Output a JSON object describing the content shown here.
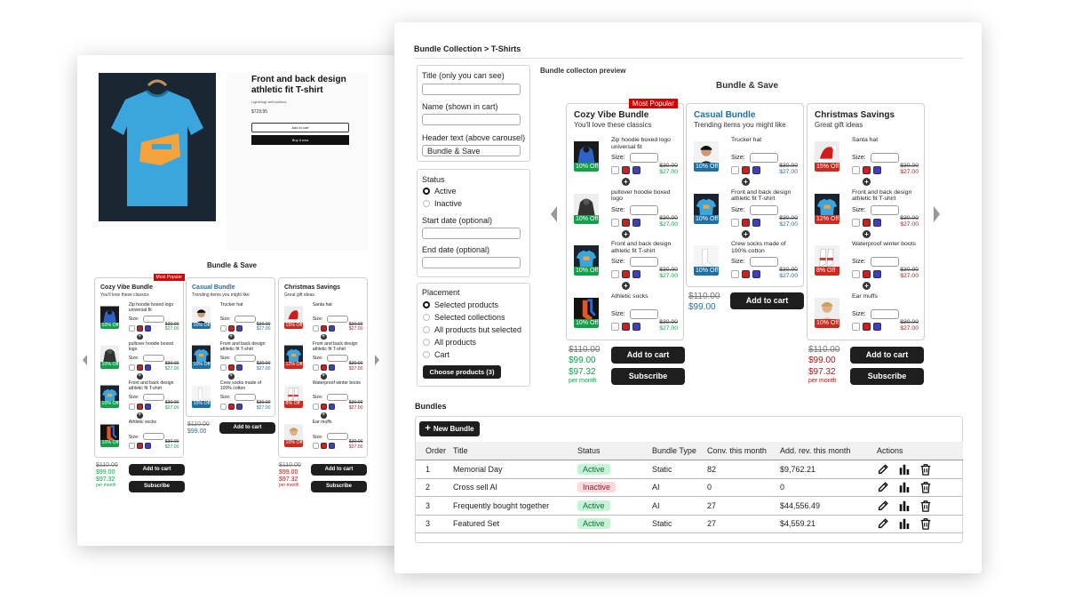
{
  "left_page": {
    "product_title": "Front and back design athletic fit T-shirt",
    "vendor": "LightningLabSolutions",
    "price": "$729.95",
    "add_to_cart": "Add to cart",
    "buy_now": "Buy it now",
    "bundle_heading": "Bundle & Save"
  },
  "preview": {
    "breadcrumb": "Bundle Collection > T-Shirts",
    "preview_label": "Bundle collecton preview",
    "heading": "Bundle & Save"
  },
  "bundles_preview": [
    {
      "name": "Cozy Vibe Bundle",
      "tagline": "You'll love these classics",
      "ribbon": "Most Popular",
      "items": [
        {
          "name": "Zip hoodie boxed logo universal fit",
          "badge": "10% Off",
          "size_label": "Size:",
          "old": "$30.00",
          "new": "$27.00",
          "img": "hoodie-blue"
        },
        {
          "name": "pullover hoodie boxed logo",
          "badge": "10% Off",
          "size_label": "Size:",
          "old": "$30.00",
          "new": "$27.00",
          "img": "hoodie-dark"
        },
        {
          "name": "Front and back design athletic fit T-shirt",
          "badge": "10% Off",
          "size_label": "Size:",
          "old": "$30.00",
          "new": "$27.00",
          "img": "tshirt-blue"
        },
        {
          "name": "Athletic socks",
          "badge": "10% Off",
          "size_label": "Size:",
          "old": "$30.00",
          "new": "$27.00",
          "img": "socks-orange"
        }
      ],
      "total_old": "$110.00",
      "total_new": "$99.00",
      "sub_price": "$97.32",
      "per_month": "per month",
      "add_to_cart": "Add to cart",
      "subscribe": "Subscribe"
    },
    {
      "name": "Casual Bundle",
      "tagline": "Trending items you might like",
      "items": [
        {
          "name": "Trucker hat",
          "badge": "10% Off",
          "size_label": "Size:",
          "old": "$30.00",
          "new": "$27.00",
          "img": "person"
        },
        {
          "name": "Front and back design athletic fit T-shirt",
          "badge": "10% Off",
          "size_label": "Size:",
          "old": "$30.00",
          "new": "$27.00",
          "img": "tshirt-blue"
        },
        {
          "name": "Crew socks made of 100% cotton",
          "badge": "10% Off",
          "size_label": "Size:",
          "old": "$30.00",
          "new": "$27.00",
          "img": "socks-white"
        }
      ],
      "total_old": "$110.00",
      "total_new": "$99.00",
      "add_to_cart": "Add to cart"
    },
    {
      "name": "Christmas Savings",
      "tagline": "Great gift ideas",
      "items": [
        {
          "name": "Santa hat",
          "badge": "15% Off",
          "size_label": "Size:",
          "old": "$30.00",
          "new": "$27.00",
          "img": "santa"
        },
        {
          "name": "Front and back design athletic fit T-shirt",
          "badge": "12% Off",
          "size_label": "Size:",
          "old": "$30.00",
          "new": "$27.00",
          "img": "tshirt-blue"
        },
        {
          "name": "Waterproof winter boots",
          "badge": "8% Off",
          "size_label": "Size:",
          "old": "$30.00",
          "new": "$27.00",
          "img": "boots"
        },
        {
          "name": "Ear muffs",
          "badge": "10% Off",
          "size_label": "Size:",
          "old": "$30.00",
          "new": "$27.00",
          "img": "person2"
        }
      ],
      "total_old": "$110.00",
      "total_new": "$99.00",
      "sub_price": "$97.32",
      "per_month": "per month",
      "add_to_cart": "Add to cart",
      "subscribe": "Subscribe"
    }
  ],
  "form": {
    "title_label": "Title (only you can see)",
    "name_label": "Name (shown in cart)",
    "header_label": "Header text (above carousel)",
    "header_value": "Bundle & Save",
    "status_label": "Status",
    "status_options": [
      "Active",
      "Inactive"
    ],
    "start_label": "Start date (optional)",
    "end_label": "End date (optional)",
    "placement_label": "Placement",
    "placement_options": [
      "Selected products",
      "Selected collections",
      "All products but selected",
      "All products",
      "Cart"
    ],
    "choose_button": "Choose products (3)"
  },
  "bundles_table": {
    "heading": "Bundles",
    "new_button": "New Bundle",
    "columns": [
      "Order",
      "Title",
      "Status",
      "Bundle Type",
      "Conv. this month",
      "Add. rev. this month",
      "Actions"
    ],
    "rows": [
      {
        "order": "1",
        "title": "Memorial Day",
        "status": "Active",
        "type": "Static",
        "conv": "82",
        "rev": "$9,762.21"
      },
      {
        "order": "2",
        "title": "Cross sell AI",
        "status": "Inactive",
        "type": "AI",
        "conv": "0",
        "rev": "0"
      },
      {
        "order": "3",
        "title": "Frequently bought together",
        "status": "Active",
        "type": "AI",
        "conv": "27",
        "rev": "$44,556.49"
      },
      {
        "order": "3",
        "title": "Featured Set",
        "status": "Active",
        "type": "Static",
        "conv": "27",
        "rev": "$4,559.21"
      }
    ]
  },
  "colors": {
    "accent_red": "#d60000",
    "accent_blue": "#1e6fa8",
    "green": "#14a04a",
    "dark_button": "#1e1e1e"
  }
}
